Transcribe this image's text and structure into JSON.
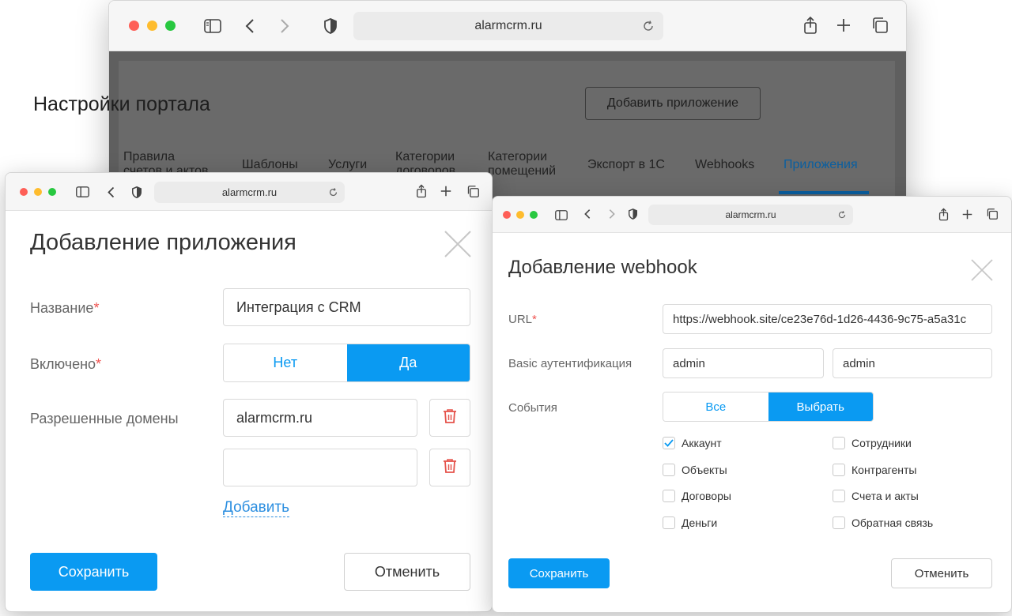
{
  "browser": {
    "url_back": "alarmcrm.ru",
    "url_left": "alarmcrm.ru",
    "url_right": "alarmcrm.ru"
  },
  "portal": {
    "title": "Настройки портала",
    "add_app_button": "Добавить приложение",
    "tabs": [
      {
        "label_line1": "Правила",
        "label_line2": "счетов и актов"
      },
      {
        "label_line1": "Шаблоны",
        "label_line2": ""
      },
      {
        "label_line1": "Услуги",
        "label_line2": ""
      },
      {
        "label_line1": "Категории",
        "label_line2": "договоров"
      },
      {
        "label_line1": "Категории",
        "label_line2": "помещений"
      },
      {
        "label_line1": "Экспорт в 1С",
        "label_line2": ""
      },
      {
        "label_line1": "Webhooks",
        "label_line2": ""
      },
      {
        "label_line1": "Приложения",
        "label_line2": ""
      }
    ],
    "active_tab": "Приложения"
  },
  "app_modal": {
    "title": "Добавление приложения",
    "name_label": "Название",
    "name_value": "Интеграция с CRM",
    "enabled_label": "Включено",
    "enabled_options": [
      "Нет",
      "Да"
    ],
    "enabled_selected": "Да",
    "domains_label": "Разрешенные домены",
    "domains": [
      "alarmcrm.ru",
      ""
    ],
    "add_link": "Добавить",
    "save_button": "Сохранить",
    "cancel_button": "Отменить",
    "required_mark": "*"
  },
  "webhook_modal": {
    "title": "Добавление webhook",
    "url_label": "URL",
    "url_value": "https://webhook.site/ce23e76d-1d26-4436-9c75-a5a31c",
    "auth_label": "Basic аутентификация",
    "auth_user": "admin",
    "auth_password": "admin",
    "events_label": "События",
    "events_options": [
      "Все",
      "Выбрать"
    ],
    "events_selected": "Выбрать",
    "events": [
      {
        "label": "Аккаунт",
        "checked": true
      },
      {
        "label": "Сотрудники",
        "checked": false
      },
      {
        "label": "Объекты",
        "checked": false
      },
      {
        "label": "Контрагенты",
        "checked": false
      },
      {
        "label": "Договоры",
        "checked": false
      },
      {
        "label": "Счета и акты",
        "checked": false
      },
      {
        "label": "Деньги",
        "checked": false
      },
      {
        "label": "Обратная связь",
        "checked": false
      }
    ],
    "save_button": "Сохранить",
    "cancel_button": "Отменить",
    "required_mark": "*"
  },
  "colors": {
    "accent": "#0a9af2",
    "required": "#ef5350",
    "link": "#2d8fe0",
    "trash": "#e5534b",
    "active_tab": "#0a5fa0"
  }
}
